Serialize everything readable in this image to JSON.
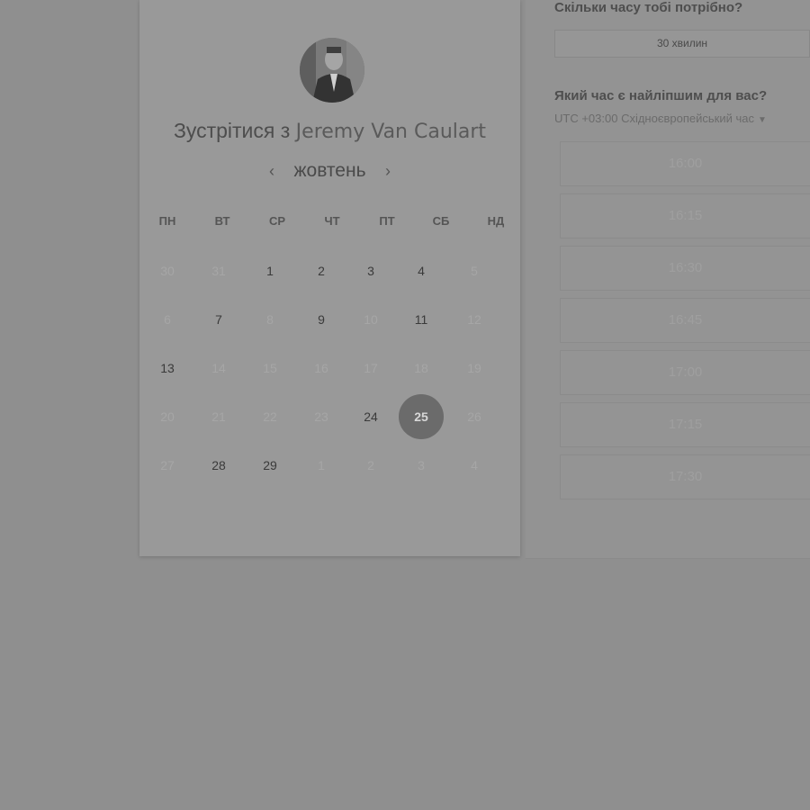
{
  "calendar": {
    "heading_prefix": "Зустрітися з",
    "host_name": "Jeremy Van Caulart",
    "month": "жовтень",
    "prev_arrow": "‹",
    "next_arrow": "›",
    "weekdays": [
      "ПН",
      "ВТ",
      "СР",
      "ЧТ",
      "ПТ",
      "СБ",
      "НД"
    ],
    "weeks": [
      [
        {
          "d": "30",
          "s": "u"
        },
        {
          "d": "31",
          "s": "u"
        },
        {
          "d": "1",
          "s": "a"
        },
        {
          "d": "2",
          "s": "a"
        },
        {
          "d": "3",
          "s": "a"
        },
        {
          "d": "4",
          "s": "a"
        },
        {
          "d": "5",
          "s": "u"
        }
      ],
      [
        {
          "d": "6",
          "s": "u"
        },
        {
          "d": "7",
          "s": "a"
        },
        {
          "d": "8",
          "s": "u"
        },
        {
          "d": "9",
          "s": "a"
        },
        {
          "d": "10",
          "s": "u"
        },
        {
          "d": "11",
          "s": "a"
        },
        {
          "d": "12",
          "s": "u"
        }
      ],
      [
        {
          "d": "13",
          "s": "a"
        },
        {
          "d": "14",
          "s": "u"
        },
        {
          "d": "15",
          "s": "u"
        },
        {
          "d": "16",
          "s": "u"
        },
        {
          "d": "17",
          "s": "u"
        },
        {
          "d": "18",
          "s": "u"
        },
        {
          "d": "19",
          "s": "u"
        }
      ],
      [
        {
          "d": "20",
          "s": "u"
        },
        {
          "d": "21",
          "s": "u"
        },
        {
          "d": "22",
          "s": "u"
        },
        {
          "d": "23",
          "s": "u"
        },
        {
          "d": "24",
          "s": "a"
        },
        {
          "d": "25",
          "s": "selected"
        },
        {
          "d": "26",
          "s": "u"
        }
      ],
      [
        {
          "d": "27",
          "s": "u"
        },
        {
          "d": "28",
          "s": "a"
        },
        {
          "d": "29",
          "s": "a"
        },
        {
          "d": "1",
          "s": "u"
        },
        {
          "d": "2",
          "s": "u"
        },
        {
          "d": "3",
          "s": "u"
        },
        {
          "d": "4",
          "s": "u"
        }
      ]
    ]
  },
  "booking": {
    "duration_question": "Скільки часу тобі потрібно?",
    "duration_value": "30 хвилин",
    "time_question": "Який час є найліпшим для вас?",
    "timezone": "UTC +03:00 Східноєвропейський час",
    "caret": "▼",
    "slots": [
      "16:00",
      "16:15",
      "16:30",
      "16:45",
      "17:00",
      "17:15",
      "17:30"
    ]
  },
  "icons": {
    "prev": "chevron-left-icon",
    "next": "chevron-right-icon",
    "timezone_caret": "caret-down-icon"
  },
  "colors": {
    "overlay": "#8f8f8f",
    "selected_day": "#6b6b6b"
  }
}
